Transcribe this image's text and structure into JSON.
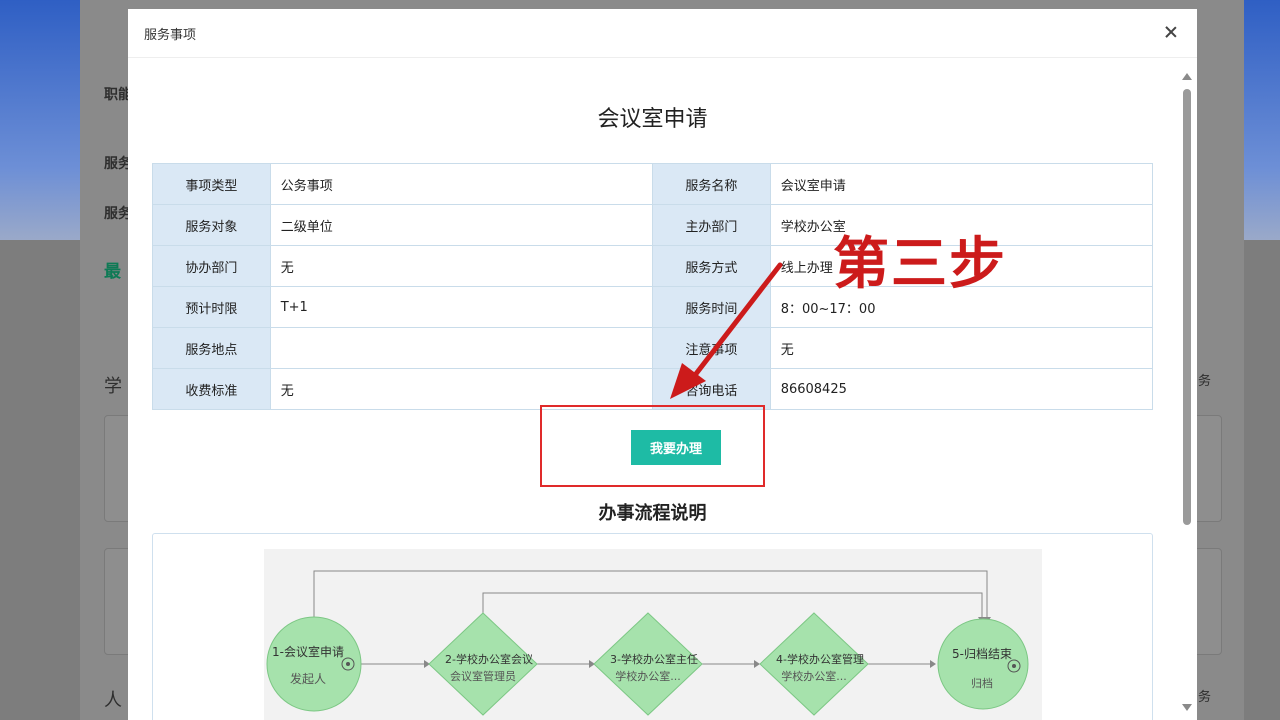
{
  "background": {
    "labels": [
      "职能",
      "服务",
      "服务",
      "最",
      "学",
      "人"
    ],
    "side_labels": [
      "务",
      "务"
    ]
  },
  "modal": {
    "title": "服务事项",
    "service_name": "会议室申请",
    "info_rows": [
      {
        "l1": "事项类型",
        "v1": "公务事项",
        "l2": "服务名称",
        "v2": "会议室申请"
      },
      {
        "l1": "服务对象",
        "v1": "二级单位",
        "l2": "主办部门",
        "v2": "学校办公室"
      },
      {
        "l1": "协办部门",
        "v1": "无",
        "l2": "服务方式",
        "v2": "线上办理"
      },
      {
        "l1": "预计时限",
        "v1": "T+1",
        "l2": "服务时间",
        "v2": "8：00~17：00"
      },
      {
        "l1": "服务地点",
        "v1": "",
        "l2": "注意事项",
        "v2": "无"
      },
      {
        "l1": "收费标准",
        "v1": "无",
        "l2": "咨询电话",
        "v2": "86608425"
      }
    ],
    "apply_label": "我要办理",
    "step_annotation": "第三步",
    "flow_title": "办事流程说明",
    "flow_nodes": [
      {
        "line1": "1-会议室申请",
        "line2": "发起人"
      },
      {
        "line1": "2-学校办公室会议",
        "line2": "会议室管理员"
      },
      {
        "line1": "3-学校办公室主任",
        "line2": "学校办公室..."
      },
      {
        "line1": "4-学校办公室管理",
        "line2": "学校办公室..."
      },
      {
        "line1": "5-归档结束",
        "line2": "归档"
      }
    ]
  },
  "colors": {
    "accent": "#1ebba5",
    "annotation_red": "#cc1b1b",
    "label_bg": "#dae8f5",
    "flow_green": "#a6e2ac"
  }
}
